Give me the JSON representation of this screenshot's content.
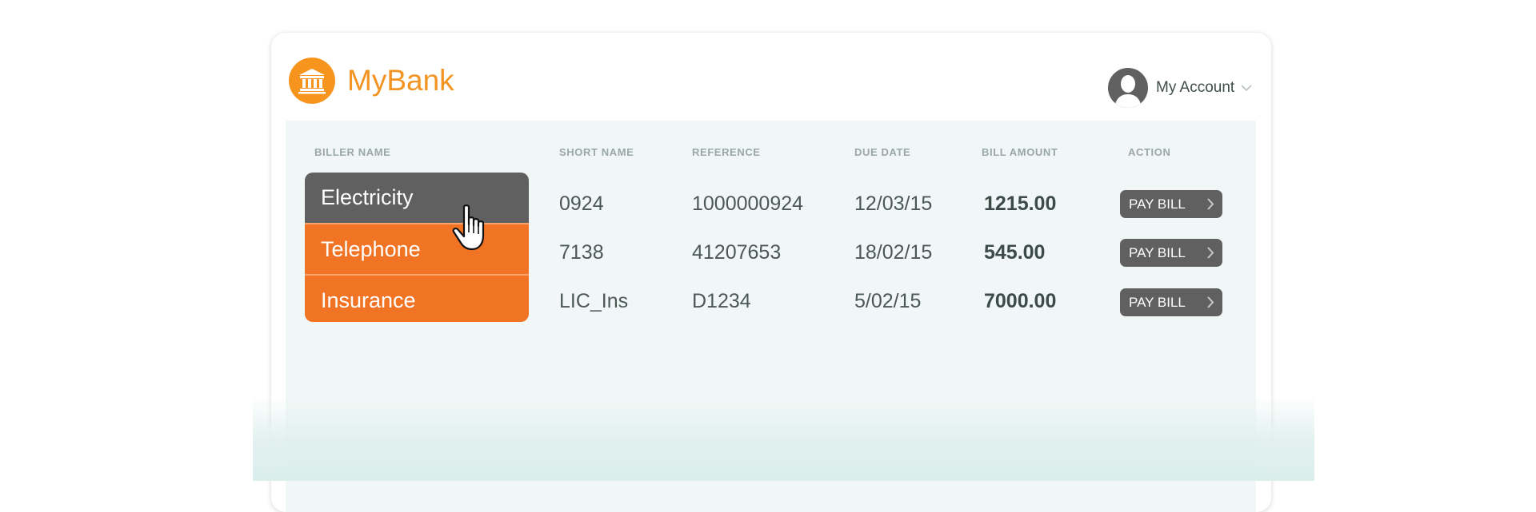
{
  "app": {
    "brand": "MyBank",
    "account_label": "My Account"
  },
  "icons": {
    "logo": "bank-building-icon",
    "avatar": "user-avatar-icon",
    "account_chevron": "chevron-down-icon",
    "button_chevron": "chevron-right-icon",
    "cursor": "hand-pointer-cursor-icon"
  },
  "colors": {
    "brand_orange": "#f39321",
    "biller_orange": "#f07423",
    "selected_gray": "#606060",
    "panel_bg": "#f1f7f6"
  },
  "table": {
    "headers": {
      "biller_name": "BILLER NAME",
      "short_name": "SHORT NAME",
      "reference": "REFERENCE",
      "due_date": "DUE DATE",
      "bill_amount": "BILL AMOUNT",
      "action": "ACTION"
    },
    "rows": [
      {
        "biller": "Electricity",
        "short_name": "0924",
        "reference": "1000000924",
        "due_date": "12/03/15",
        "amount": "1215.00",
        "action": "PAY BILL",
        "selected": true
      },
      {
        "biller": "Telephone",
        "short_name": "7138",
        "reference": "41207653",
        "due_date": "18/02/15",
        "amount": "545.00",
        "action": "PAY BILL",
        "selected": false
      },
      {
        "biller": "Insurance",
        "short_name": "LIC_Ins",
        "reference": "D1234",
        "due_date": "5/02/15",
        "amount": "7000.00",
        "action": "PAY BILL",
        "selected": false
      }
    ]
  }
}
